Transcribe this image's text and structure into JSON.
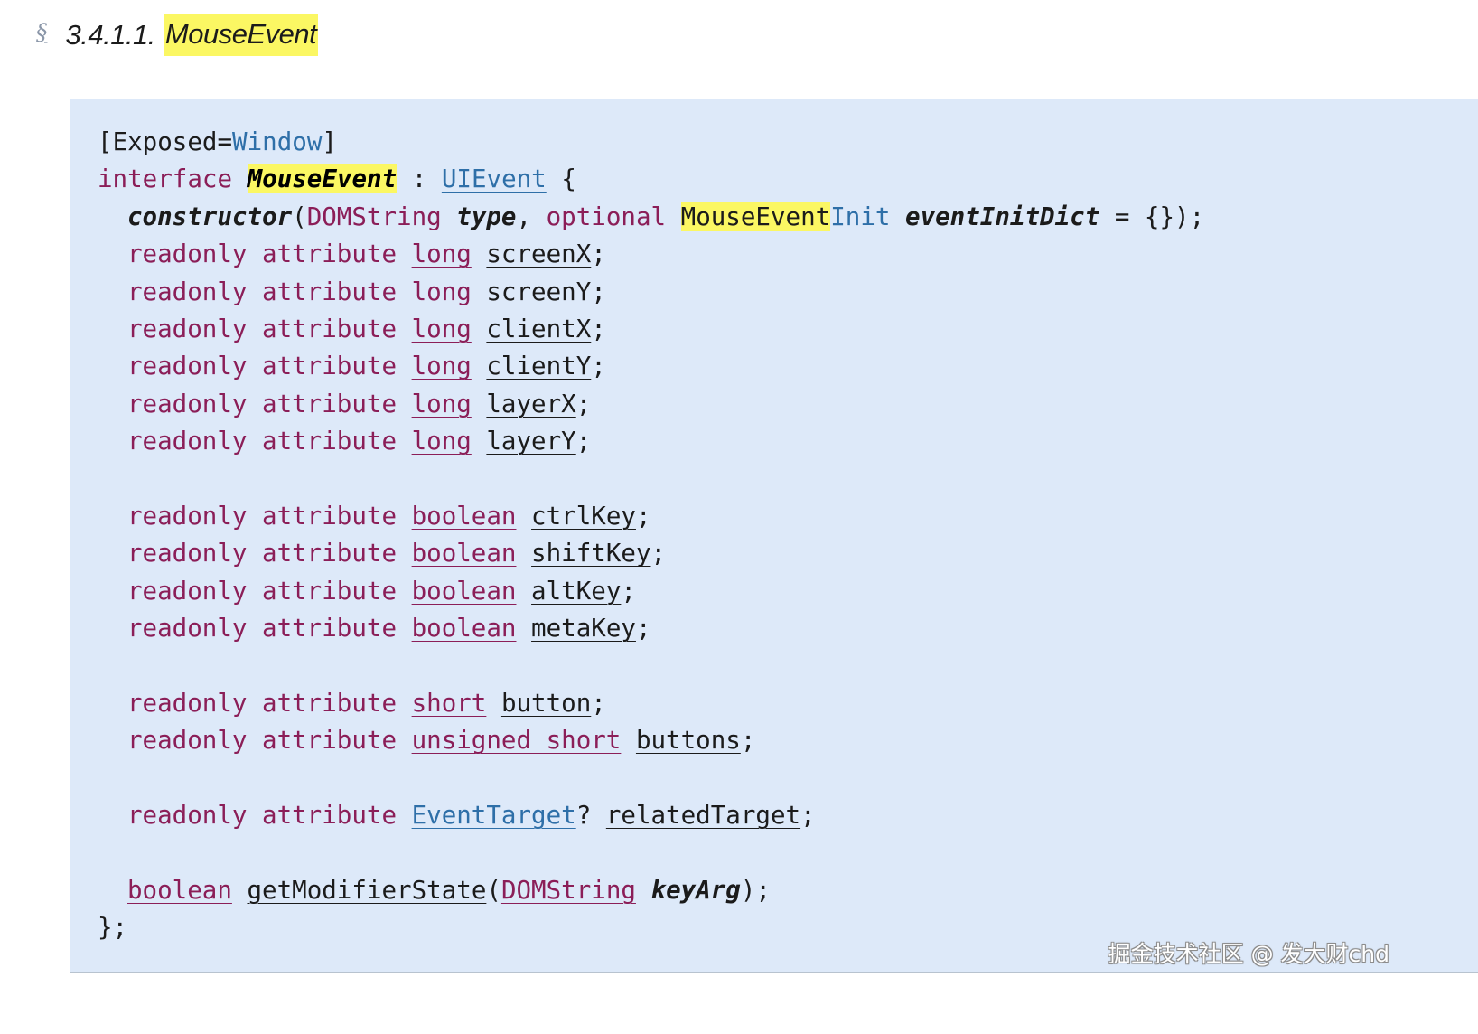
{
  "heading": {
    "section_symbol": "§",
    "number": "3.4.1.1.",
    "title": "MouseEvent"
  },
  "idl": {
    "ext_attr": {
      "open": "[",
      "name": "Exposed",
      "eq": "=",
      "value": "Window",
      "close": "]"
    },
    "interface_line": {
      "keyword": "interface",
      "name": "MouseEvent",
      "colon": ":",
      "parent": "UIEvent",
      "brace": "{"
    },
    "constructor_line": {
      "name": "constructor",
      "paren_open": "(",
      "arg1_type": "DOMString",
      "arg1_name": "type",
      "comma": ",",
      "optional": "optional",
      "arg2_type_a": "MouseEvent",
      "arg2_type_b": "Init",
      "arg2_name": "eventInitDict",
      "tail": "= {});"
    },
    "attr_keyword": "readonly attribute",
    "attributes_long": [
      {
        "type": "long",
        "name": "screenX"
      },
      {
        "type": "long",
        "name": "screenY"
      },
      {
        "type": "long",
        "name": "clientX"
      },
      {
        "type": "long",
        "name": "clientY"
      },
      {
        "type": "long",
        "name": "layerX"
      },
      {
        "type": "long",
        "name": "layerY"
      }
    ],
    "attributes_boolean": [
      {
        "type": "boolean",
        "name": "ctrlKey"
      },
      {
        "type": "boolean",
        "name": "shiftKey"
      },
      {
        "type": "boolean",
        "name": "altKey"
      },
      {
        "type": "boolean",
        "name": "metaKey"
      }
    ],
    "attributes_buttons": [
      {
        "type": "short",
        "name": "button"
      },
      {
        "type": "unsigned short",
        "name": "buttons"
      }
    ],
    "related_target": {
      "type": "EventTarget",
      "nullable": "?",
      "name": "relatedTarget"
    },
    "method": {
      "return_type": "boolean",
      "name": "getModifierState",
      "paren_open": "(",
      "arg_type": "DOMString",
      "arg_name": "keyArg",
      "tail": ");"
    },
    "close": "};",
    "semicolon": ";"
  },
  "watermark": "掘金技术社区 @ 发大财chd",
  "colors": {
    "keyword": "#8b1e58",
    "link_blue": "#2e6fa8",
    "highlight": "#fbf763",
    "idl_background": "#dde9f9"
  }
}
